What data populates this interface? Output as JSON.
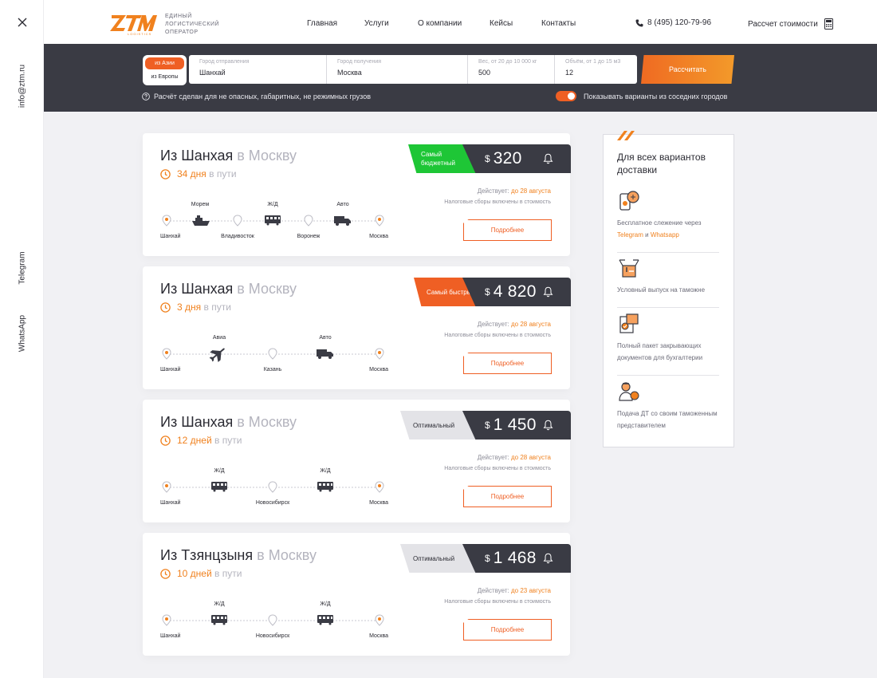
{
  "sidebar": {
    "email": "info@ztm.ru",
    "telegram": "Telegram",
    "whatsapp": "WhatsApp"
  },
  "header": {
    "logo_text": "Единый логистический оператор",
    "nav": [
      "Главная",
      "Услуги",
      "О компании",
      "Кейсы",
      "Контакты"
    ],
    "phone": "8 (495) 120-79-96",
    "calc_label": "Рассчет стоимости"
  },
  "search": {
    "seg_asia": "из Азии",
    "seg_europe": "из Европы",
    "from_label": "Город отправления",
    "from_value": "Шанхай",
    "to_label": "Город получения",
    "to_value": "Москва",
    "weight_label": "Вес, от 20 до 10 000 кг",
    "weight_value": "500",
    "volume_label": "Объём, от 1 до 15 м3",
    "volume_value": "12",
    "button": "Рассчитать",
    "note": "Расчёт сделан для не опасных, габаритных, не режимных грузов",
    "toggle_label": "Показывать варианты из соседних городов"
  },
  "cards": [
    {
      "from": "Из Шанхая",
      "to": "в Москву",
      "days": "34 дня",
      "days_rest": "в пути",
      "badge": "Самый бюджетный",
      "price_cur": "$",
      "price": "320",
      "valid_label": "Действует:",
      "valid_date": "до 28 августа",
      "taxes": "Налоговые сборы включены в стоимость",
      "button": "Подробнее",
      "stops": [
        "Шанхай",
        "Владивосток",
        "Воронеж",
        "Москва"
      ],
      "modes": [
        "Морем",
        "Ж/Д",
        "Авто"
      ]
    },
    {
      "from": "Из Шанхая",
      "to": "в Москву",
      "days": "3 дня",
      "days_rest": "в пути",
      "badge": "Самый быстрый",
      "price_cur": "$",
      "price": "4 820",
      "valid_label": "Действует:",
      "valid_date": "до 28 августа",
      "taxes": "Налоговые сборы включены в стоимость",
      "button": "Подробнее",
      "stops": [
        "Шанхай",
        "Казань",
        "Москва"
      ],
      "modes": [
        "Авиа",
        "Авто"
      ]
    },
    {
      "from": "Из Шанхая",
      "to": "в Москву",
      "days": "12 дней",
      "days_rest": "в пути",
      "badge": "Оптимальный",
      "price_cur": "$",
      "price": "1 450",
      "valid_label": "Действует:",
      "valid_date": "до 28 августа",
      "taxes": "Налоговые сборы включены в стоимость",
      "button": "Подробнее",
      "stops": [
        "Шанхай",
        "Новосибирск",
        "Москва"
      ],
      "modes": [
        "Ж/Д",
        "Ж/Д"
      ]
    },
    {
      "from": "Из Тзянцзыня",
      "to": "в Москву",
      "days": "10 дней",
      "days_rest": "в пути",
      "badge": "Оптимальный",
      "price_cur": "$",
      "price": "1 468",
      "valid_label": "Действует:",
      "valid_date": "до 23 августа",
      "taxes": "Налоговые сборы включены в стоимость",
      "button": "Подробнее",
      "stops": [
        "Шанхай",
        "Новосибирск",
        "Москва"
      ],
      "modes": [
        "Ж/Д",
        "Ж/Д"
      ]
    }
  ],
  "panel": {
    "title": "Для всех вариантов доставки",
    "features": [
      {
        "text_a": "Бесплатное слежение через",
        "link1": "Telegram",
        "and": "и",
        "link2": "Whatsapp"
      },
      {
        "text_a": "Условный выпуск на таможне"
      },
      {
        "text_a": "Полный пакет закрывающих документов для бухгалтерии"
      },
      {
        "text_a": "Подача ДТ со своим таможенным представителем"
      }
    ]
  },
  "colors": {
    "accent": "#ef5f24",
    "green": "#1ec636",
    "dark": "#3a3b44",
    "orange_text": "#f0811e"
  }
}
